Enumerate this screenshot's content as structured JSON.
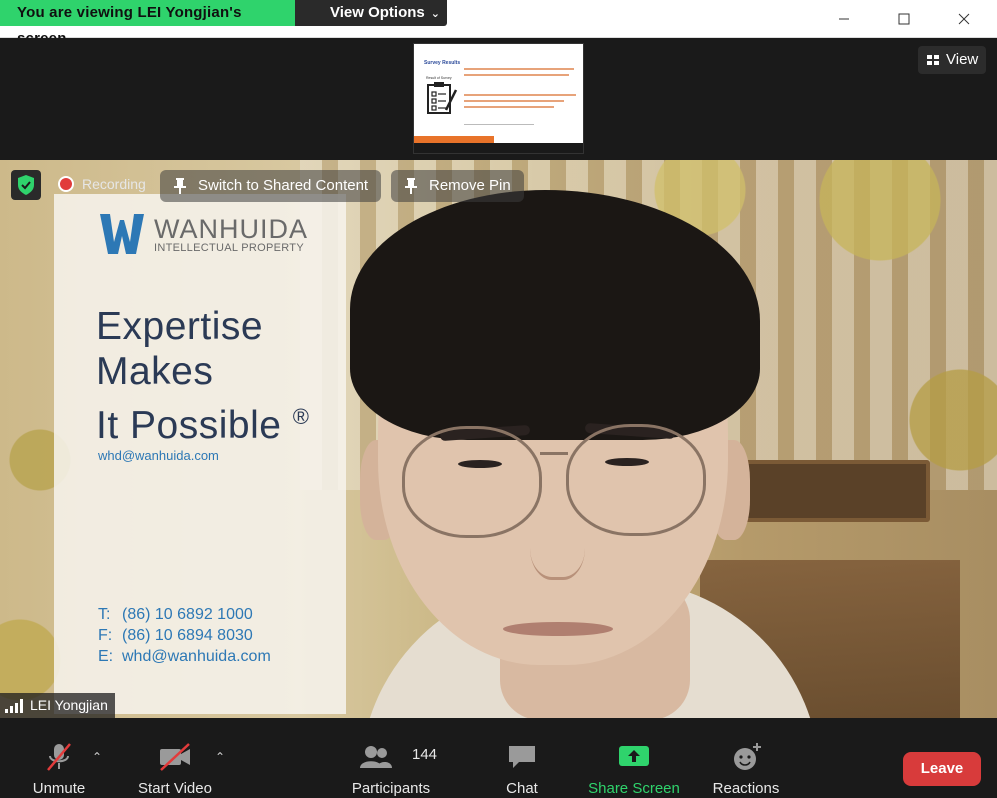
{
  "banner": {
    "viewing_text": "You are viewing LEI Yongjian's screen",
    "view_options_label": "View Options"
  },
  "thumbnail": {
    "title": "Survey Results",
    "subtitle": "Result of Survey"
  },
  "view_button": {
    "label": "View"
  },
  "video": {
    "recording_label": "Recording",
    "switch_label": "Switch to Shared Content",
    "remove_pin_label": "Remove Pin",
    "participant_name": "LEI Yongjian"
  },
  "background_card": {
    "brand_name": "WANHUIDA",
    "brand_sub": "INTELLECTUAL PROPERTY",
    "tagline": [
      "Expertise",
      "Makes",
      "It Possible"
    ],
    "registered_mark": "®",
    "email_small": "whd@wanhuida.com",
    "contacts": [
      {
        "key": "T:",
        "value": "(86) 10 6892 1000"
      },
      {
        "key": "F:",
        "value": "(86) 10 6894 8030"
      },
      {
        "key": "E:",
        "value": "whd@wanhuida.com"
      }
    ]
  },
  "toolbar": {
    "unmute_label": "Unmute",
    "start_video_label": "Start Video",
    "participants_label": "Participants",
    "participants_count": "144",
    "chat_label": "Chat",
    "share_label": "Share Screen",
    "reactions_label": "Reactions",
    "leave_label": "Leave"
  },
  "colors": {
    "banner_green": "#2fd36c",
    "leave_red": "#d83b3b",
    "share_green": "#2fd36c",
    "toolbar_bg": "#1a1a1a"
  },
  "icons": {
    "window": [
      "minimize-icon",
      "maximize-icon",
      "close-icon"
    ],
    "toolbar": [
      "microphone-muted-icon",
      "video-off-icon",
      "participants-icon",
      "chat-icon",
      "share-screen-icon",
      "reactions-icon"
    ]
  }
}
